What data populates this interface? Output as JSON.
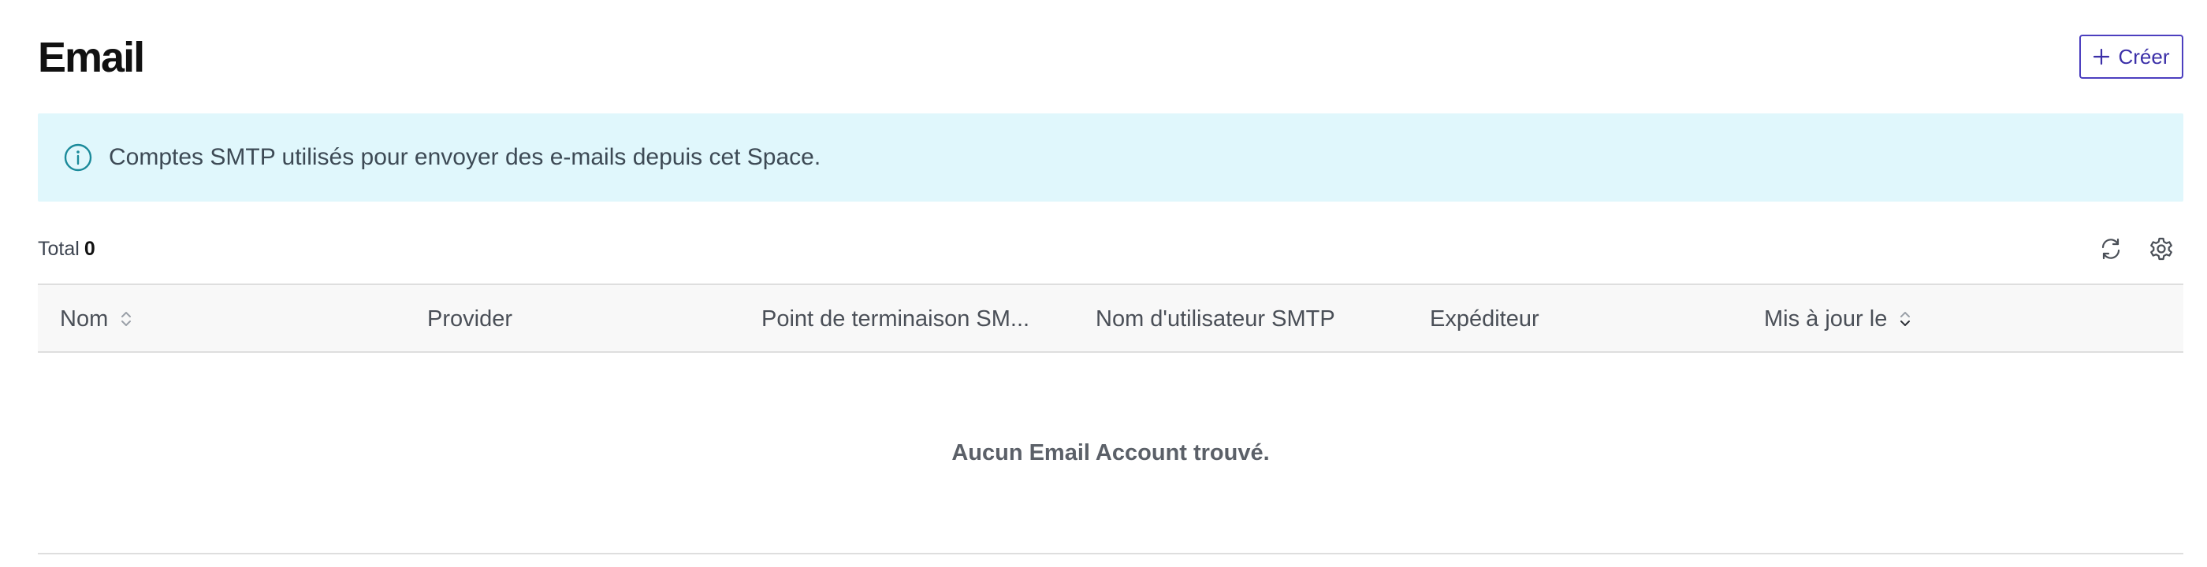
{
  "header": {
    "title": "Email",
    "create_label": "Créer"
  },
  "banner": {
    "text": "Comptes SMTP utilisés pour envoyer des e-mails depuis cet Space."
  },
  "toolbar": {
    "total_label": "Total",
    "total_count": "0"
  },
  "table": {
    "columns": [
      {
        "label": "Nom",
        "sort": "both"
      },
      {
        "label": "Provider"
      },
      {
        "label": "Point de terminaison SM..."
      },
      {
        "label": "Nom d'utilisateur SMTP"
      },
      {
        "label": "Expéditeur"
      },
      {
        "label": "Mis à jour le",
        "sort": "desc-active"
      }
    ],
    "empty_text": "Aucun Email Account trouvé."
  },
  "colors": {
    "accent": "#4c3fbf",
    "banner_bg": "#e0f7fc",
    "info_icon": "#1a8a9a",
    "border": "#dedede"
  },
  "icons": {
    "create": "plus-icon",
    "info": "info-circle-icon",
    "refresh": "refresh-icon",
    "settings": "gear-icon",
    "sort": "sort-icon"
  }
}
